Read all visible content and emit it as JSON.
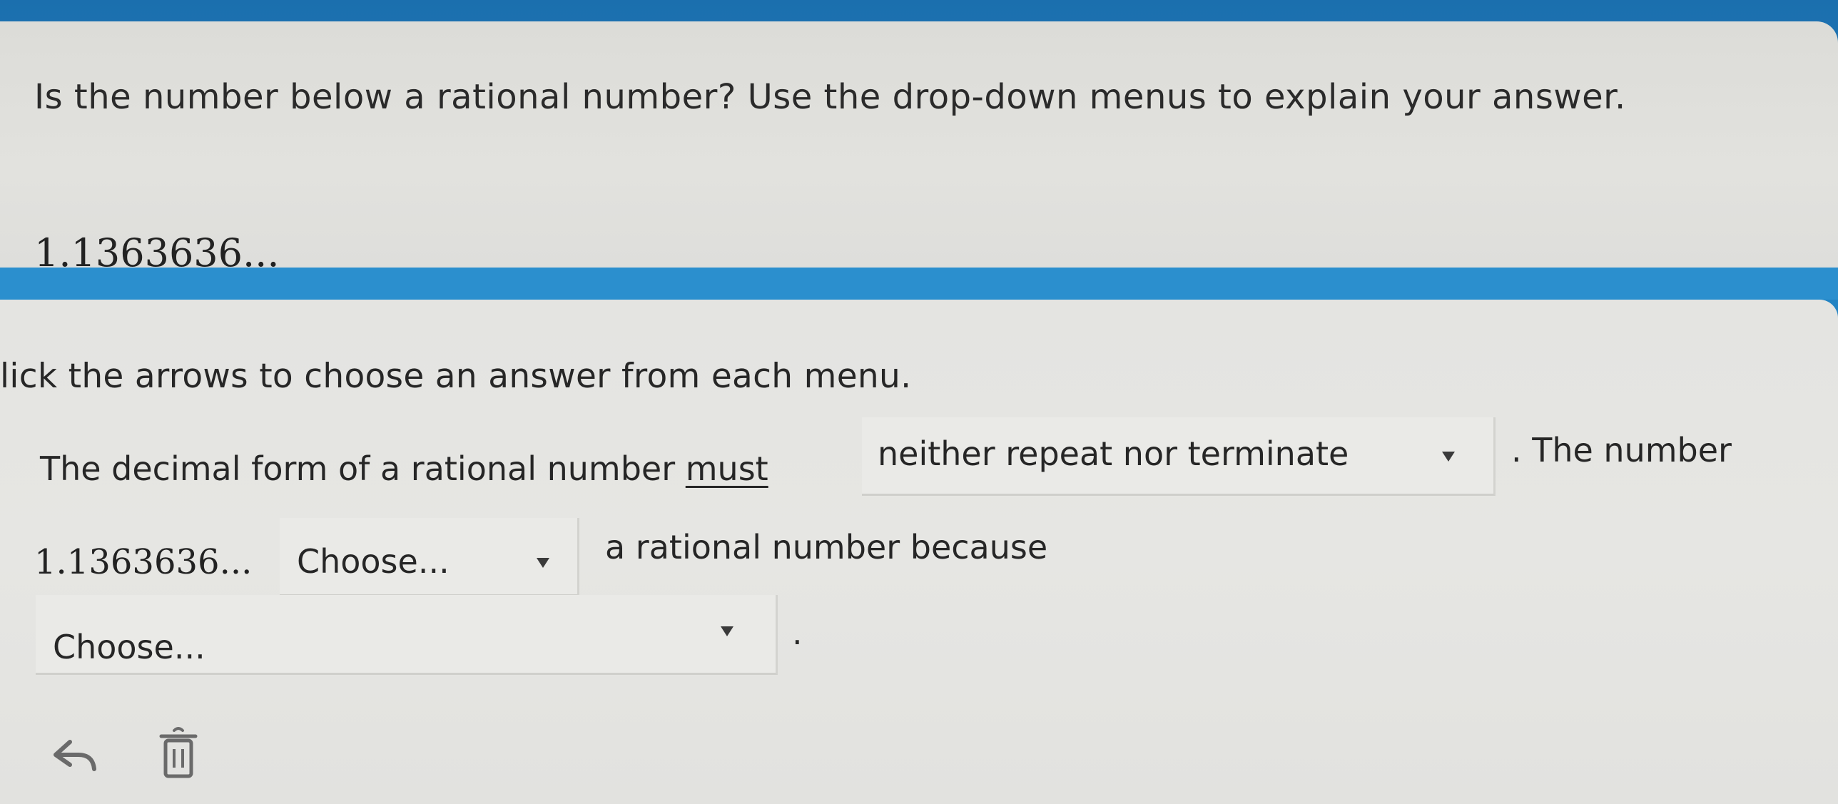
{
  "question": {
    "prompt": "Is the number below a rational number? Use the drop-down menus to explain your answer.",
    "number": "1.1363636..."
  },
  "answer": {
    "instruction": "lick the arrows to choose an answer from each menu.",
    "sentence_part1": "The decimal form of a rational number ",
    "sentence_must": "must",
    "dropdown1_value": "neither repeat nor terminate",
    "sentence_part2": ". The number",
    "number": "1.1363636...",
    "dropdown2_value": "Choose...",
    "sentence_part3": "a rational number because",
    "dropdown3_value": "Choose...",
    "sentence_end": "."
  },
  "toolbar": {
    "undo_icon": "undo-arrow-icon",
    "delete_icon": "trash-icon"
  }
}
